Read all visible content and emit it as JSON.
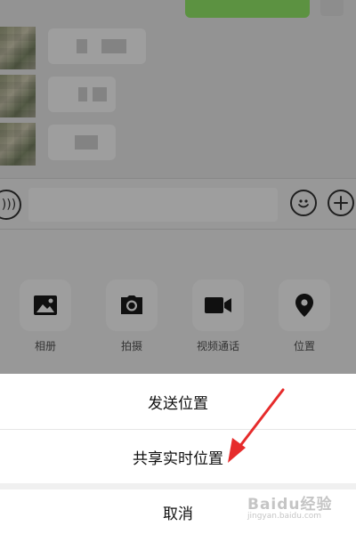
{
  "toolbar": {
    "voice_icon": "voice-input-icon",
    "emoji_icon": "emoji-icon",
    "plus_icon": "plus-icon"
  },
  "more_panel": {
    "items": [
      {
        "label": "相册",
        "icon": "album-icon"
      },
      {
        "label": "拍摄",
        "icon": "camera-icon"
      },
      {
        "label": "视频通话",
        "icon": "video-call-icon"
      },
      {
        "label": "位置",
        "icon": "location-pin-icon"
      }
    ]
  },
  "action_sheet": {
    "send_location_label": "发送位置",
    "share_live_location_label": "共享实时位置",
    "cancel_label": "取消"
  },
  "watermark": {
    "text": "Baidu经验",
    "sub": "jingyan.baidu.com"
  },
  "colors": {
    "wechat_green_bubble": "#95ec69",
    "annotation_arrow": "#e62b2b",
    "overlay": "rgba(0,0,0,0.38)"
  }
}
